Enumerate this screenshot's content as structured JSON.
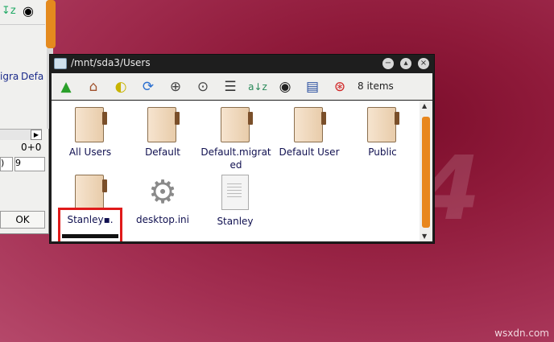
{
  "background_window": {
    "toolbar_icons": [
      "sort-az-icon",
      "eye-icon"
    ],
    "labels": [
      "igra",
      "Defa"
    ],
    "coord_value": "0+0",
    "field_a": ")",
    "field_b": "9",
    "ok_label": "OK"
  },
  "window": {
    "title": "/mnt/sda3/Users",
    "item_count": "8 items",
    "toolbar_buttons": [
      "up-icon",
      "home-icon",
      "bookmark-icon",
      "refresh-icon",
      "zoom-in-icon",
      "zoom-fit-icon",
      "list-view-icon",
      "sort-az-icon",
      "eye-icon",
      "detail-view-icon",
      "help-icon"
    ]
  },
  "files": [
    {
      "name": "All Users",
      "type": "folder"
    },
    {
      "name": "Default",
      "type": "folder"
    },
    {
      "name": "Default.migrated",
      "type": "folder"
    },
    {
      "name": "Default User",
      "type": "folder"
    },
    {
      "name": "Public",
      "type": "folder"
    },
    {
      "name": "Stanley",
      "type": "folder"
    },
    {
      "name": "desktop.ini",
      "type": "settings"
    },
    {
      "name": "Stanley",
      "type": "document"
    }
  ],
  "watermark": "wsxdn.com",
  "bg_mark": "4",
  "colors": {
    "scroll_accent": "#e8871e",
    "highlight": "#e01a1a"
  }
}
